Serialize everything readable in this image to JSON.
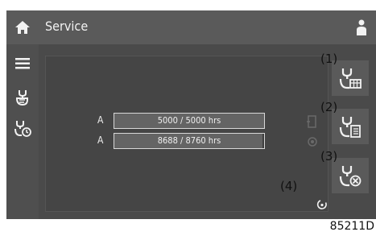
{
  "header": {
    "title": "Service"
  },
  "icons": {
    "home": "home-icon",
    "user": "user-icon",
    "menu": "menu-icon",
    "service_tool": "wrench-hand-icon",
    "service_timer": "wrench-clock-icon"
  },
  "service_rows": [
    {
      "label": "A",
      "value": "5000 / 5000 hrs",
      "progress": 1.0
    },
    {
      "label": "A",
      "value": "8688 / 8760 hrs",
      "progress": 0.99
    }
  ],
  "callouts": {
    "c1": "(1)",
    "c2": "(2)",
    "c3": "(3)",
    "c4": "(4)"
  },
  "figure_ref": "85211D",
  "colors": {
    "bar_fill": "#646464",
    "bar_border": "#d8d8d8",
    "icon": "#f2f2f2"
  }
}
